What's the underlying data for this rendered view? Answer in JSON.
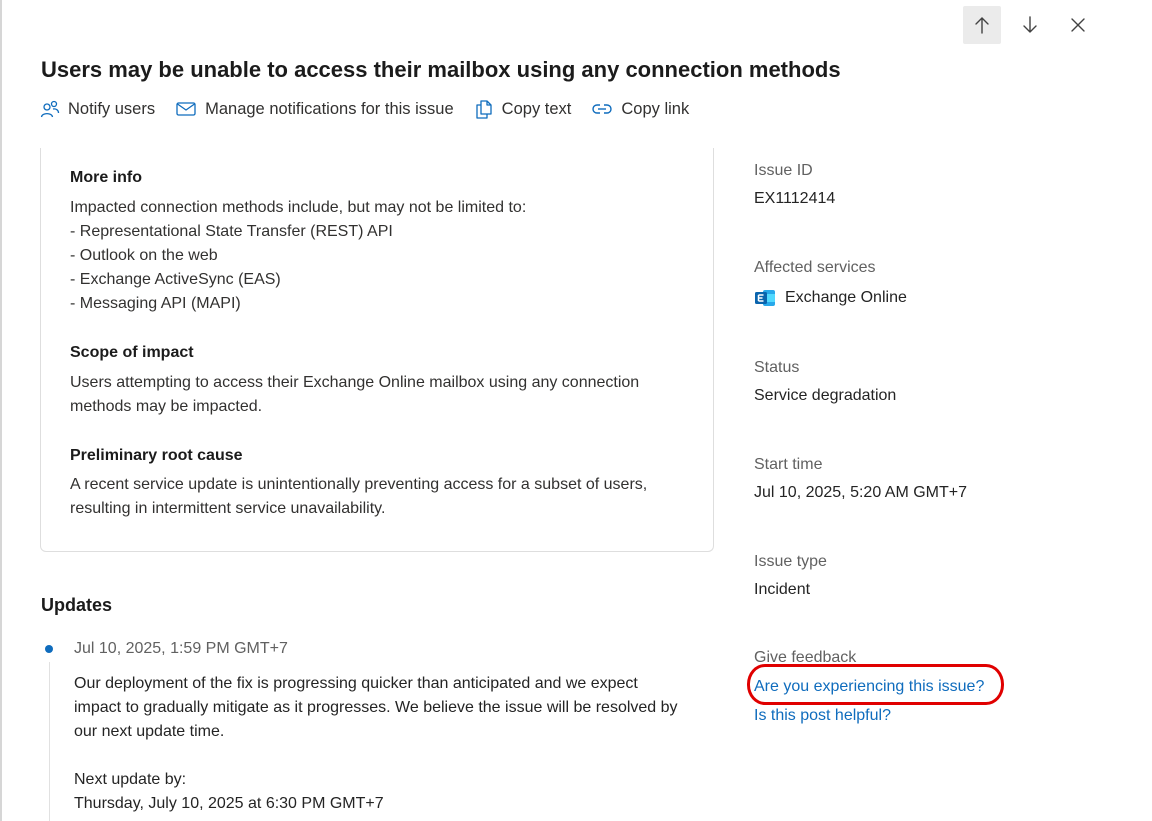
{
  "header": {
    "title": "Users may be unable to access their mailbox using any connection methods",
    "nav_icons": [
      "arrow-up-icon",
      "arrow-down-icon",
      "close-icon"
    ]
  },
  "actions": [
    {
      "label": "Notify users",
      "icon": "people-icon"
    },
    {
      "label": "Manage notifications for this issue",
      "icon": "mail-icon"
    },
    {
      "label": "Copy text",
      "icon": "copy-icon"
    },
    {
      "label": "Copy link",
      "icon": "link-icon"
    }
  ],
  "details": {
    "more_info": {
      "heading": "More info",
      "lines": [
        "Impacted connection methods include, but may not be limited to:",
        "- Representational State Transfer (REST) API",
        "- Outlook on the web",
        "- Exchange ActiveSync (EAS)",
        "- Messaging API (MAPI)"
      ]
    },
    "scope": {
      "heading": "Scope of impact",
      "lines": [
        "Users attempting to access their Exchange Online mailbox using any connection",
        "methods may be impacted."
      ]
    },
    "root_cause": {
      "heading": "Preliminary root cause",
      "lines": [
        "A recent service update is unintentionally preventing access for a subset of users,",
        "resulting in intermittent service unavailability."
      ]
    }
  },
  "updates": {
    "heading": "Updates",
    "items": [
      {
        "time": "Jul 10, 2025, 1:59 PM GMT+7",
        "lines": [
          "Our deployment of the fix is progressing quicker than anticipated and we expect",
          "impact to gradually mitigate as it progresses. We believe the issue will be resolved by",
          "our next update time.",
          "",
          "Next update by:",
          "Thursday, July 10, 2025 at 6:30 PM GMT+7"
        ]
      }
    ]
  },
  "sidebar": {
    "issue_id": {
      "label": "Issue ID",
      "value": "EX1112414"
    },
    "affected_services": {
      "label": "Affected services",
      "value": "Exchange Online",
      "icon": "exchange-icon"
    },
    "status": {
      "label": "Status",
      "value": "Service degradation"
    },
    "start_time": {
      "label": "Start time",
      "value": "Jul 10, 2025, 5:20 AM GMT+7"
    },
    "issue_type": {
      "label": "Issue type",
      "value": "Incident"
    },
    "feedback": {
      "label": "Give feedback",
      "experiencing_link": "Are you experiencing this issue?",
      "helpful_link": "Is this post helpful?"
    }
  },
  "colors": {
    "link": "#0f6cbd",
    "highlight": "#e00000",
    "accent_dot": "#0f6cbd"
  }
}
